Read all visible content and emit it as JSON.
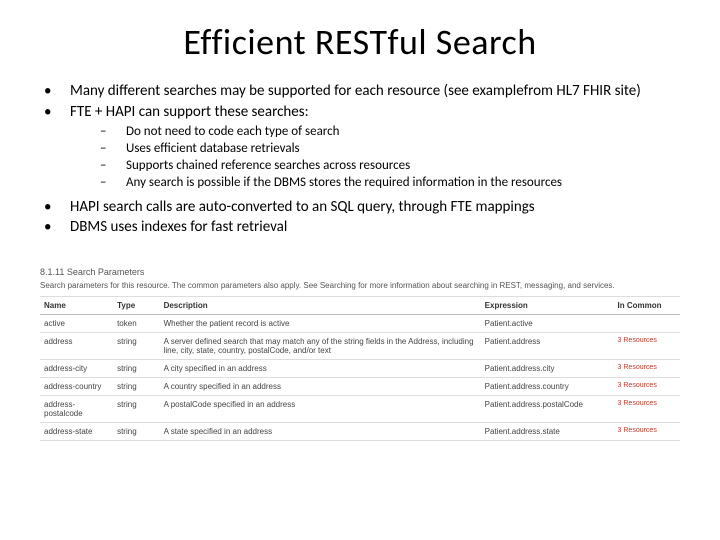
{
  "title": "Efficient RESTful Search",
  "bullets": [
    {
      "text": "Many different searches may be supported for each resource (see examplefrom HL7 FHIR site)"
    },
    {
      "text": "FTE + HAPI can support these searches:",
      "sub": [
        "Do not need to code each type of search",
        "Uses efficient database retrievals",
        "Supports chained reference searches across resources",
        "Any search is possible if the DBMS stores the required information in the resources"
      ]
    },
    {
      "text": "HAPI search calls are auto-converted to an SQL query, through FTE mappings"
    },
    {
      "text": "DBMS uses indexes for fast retrieval"
    }
  ],
  "section": {
    "number": "8.1.11",
    "heading": "Search Parameters",
    "description": "Search parameters for this resource. The common parameters also apply. See Searching for more information about searching in REST, messaging, and services."
  },
  "table": {
    "headers": [
      "Name",
      "Type",
      "Description",
      "Expression",
      "In Common"
    ],
    "rows": [
      {
        "name": "active",
        "type": "token",
        "desc": "Whether the patient record is active",
        "expr": "Patient.active",
        "inc": ""
      },
      {
        "name": "address",
        "type": "string",
        "desc": "A server defined search that may match any of the string fields in the Address, including line, city, state, country, postalCode, and/or text",
        "expr": "Patient.address",
        "inc": "3 Resources"
      },
      {
        "name": "address-city",
        "type": "string",
        "desc": "A city specified in an address",
        "expr": "Patient.address.city",
        "inc": "3 Resources"
      },
      {
        "name": "address-country",
        "type": "string",
        "desc": "A country specified in an address",
        "expr": "Patient.address.country",
        "inc": "3 Resources"
      },
      {
        "name": "address-postalcode",
        "type": "string",
        "desc": "A postalCode specified in an address",
        "expr": "Patient.address.postalCode",
        "inc": "3 Resources"
      },
      {
        "name": "address-state",
        "type": "string",
        "desc": "A state specified in an address",
        "expr": "Patient.address.state",
        "inc": "3 Resources"
      }
    ]
  }
}
